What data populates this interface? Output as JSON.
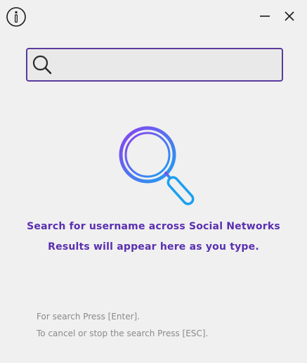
{
  "window": {
    "buttons": {
      "info_icon": "info-circle-icon",
      "minimize_icon": "minimize-icon",
      "close_icon": "close-icon"
    }
  },
  "search": {
    "value": "",
    "placeholder": "",
    "icon": "search-icon",
    "border_color": "#5b3a9e"
  },
  "empty_state": {
    "icon": "magnifier-gradient-icon",
    "gradient": [
      "#8b3ff0",
      "#1aa0f0"
    ],
    "line1": "Search for username across Social Networks",
    "line2": "Results will appear here as you type.",
    "accent_color": "#5a2fb0"
  },
  "hints": {
    "search": "For search Press [Enter].",
    "cancel": "To cancel or stop the search Press [ESC]."
  }
}
